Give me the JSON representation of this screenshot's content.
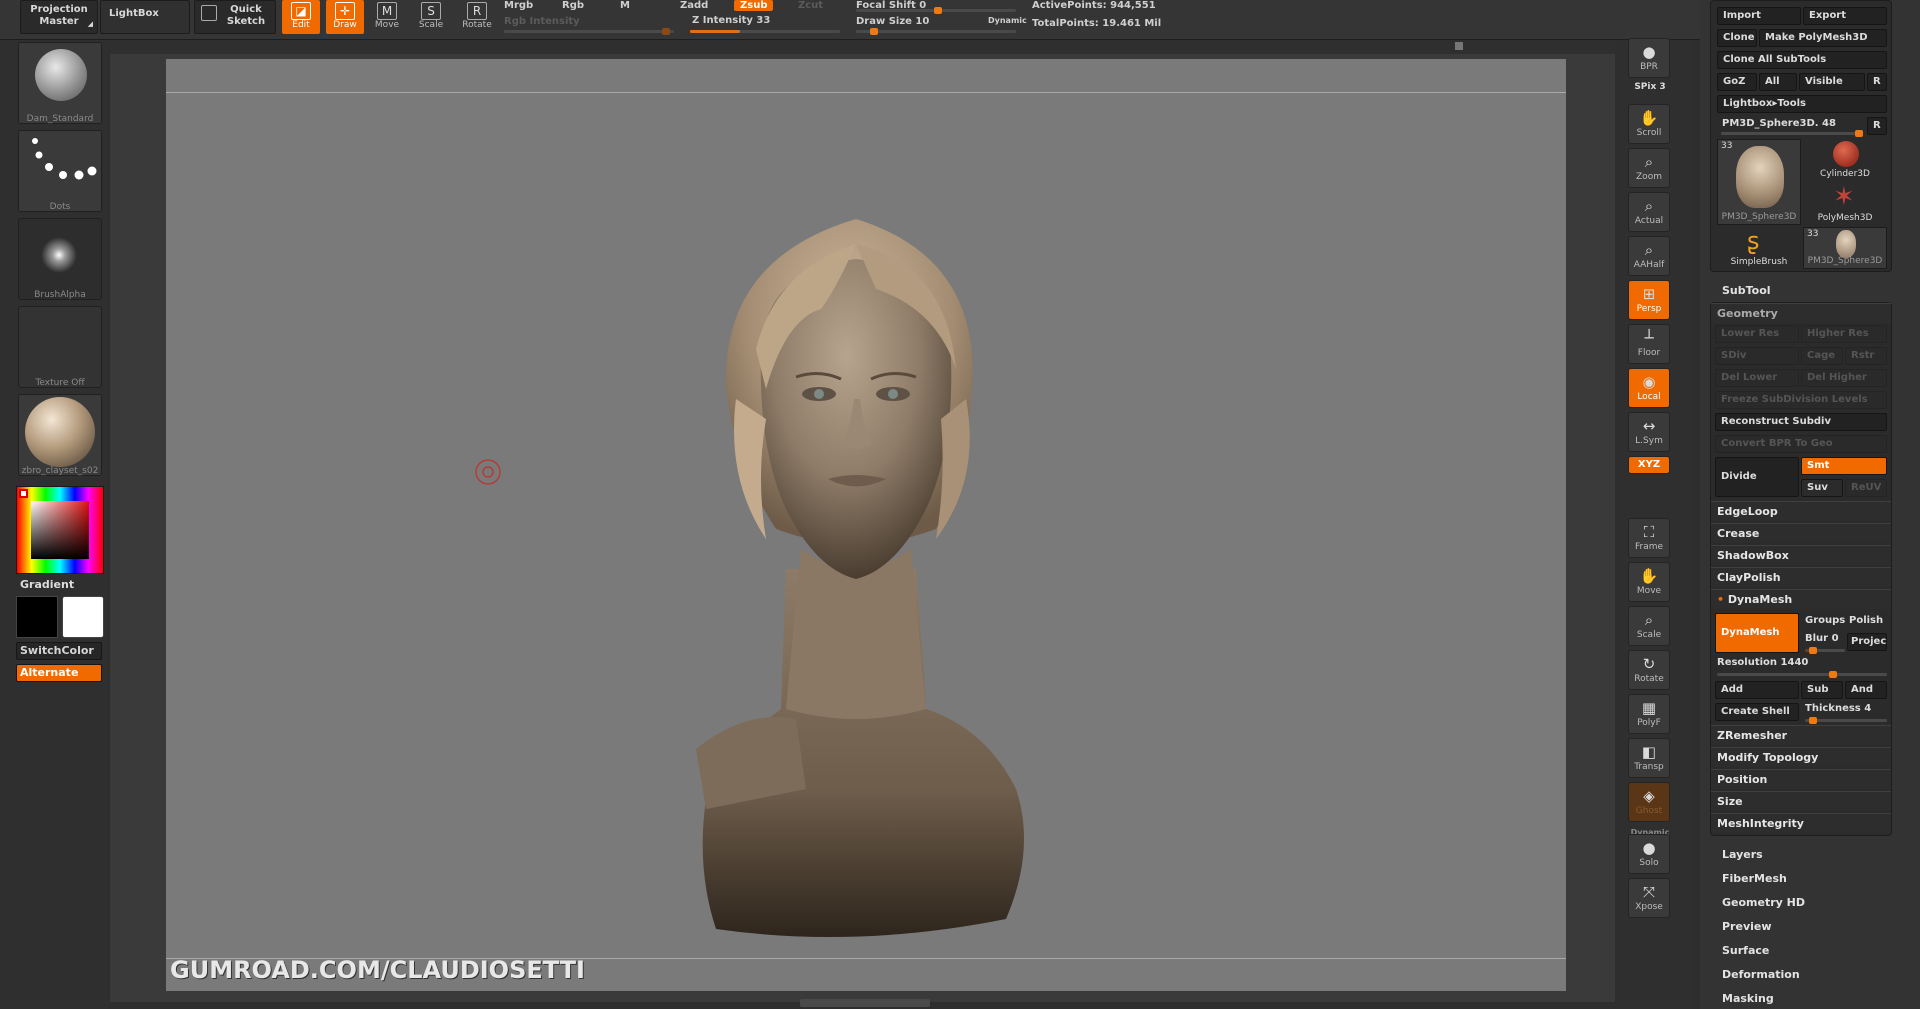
{
  "topbar": {
    "projection_master": "Projection Master",
    "lightbox": "LightBox",
    "quick_sketch": "Quick Sketch",
    "modes": [
      {
        "label": "Edit",
        "icon": "edit-icon",
        "active": true
      },
      {
        "label": "Draw",
        "icon": "draw-icon",
        "active": true
      },
      {
        "label": "Move",
        "icon": "move-icon",
        "active": false
      },
      {
        "label": "Scale",
        "icon": "scale-icon",
        "active": false
      },
      {
        "label": "Rotate",
        "icon": "rotate-icon",
        "active": false
      }
    ],
    "mrgb": "Mrgb",
    "rgb": "Rgb",
    "m": "M",
    "rgb_intensity": "Rgb Intensity",
    "zadd": "Zadd",
    "zsub": "Zsub",
    "zcut": "Zcut",
    "z_intensity": "Z Intensity 33",
    "z_intensity_value": 33,
    "focal_shift": "Focal Shift 0",
    "draw_size": "Draw Size 10",
    "draw_size_value": 10,
    "dynamic": "Dynamic",
    "active_points": "ActivePoints: 944,551",
    "total_points": "TotalPoints: 19.461 Mil"
  },
  "left_shelf": {
    "brush": "Dam_Standard",
    "stroke": "Dots",
    "alpha": "BrushAlpha",
    "texture": "Texture Off",
    "material": "zbro_clayset_s02",
    "gradient": "Gradient",
    "switch_color": "SwitchColor",
    "alternate": "Alternate",
    "main_color": "#000000",
    "secondary_color": "#ffffff",
    "accent": "#f06a00"
  },
  "canvas": {
    "watermark": "GUMROAD.COM/CLAUDIOSETTI",
    "bg_color": "#7a7a7a",
    "model_color": "#9c8a78"
  },
  "right_shelf": [
    {
      "label": "BPR",
      "icon": "bpr-icon"
    },
    {
      "label": "SPix 3",
      "icon": "spix-slider"
    },
    {
      "label": "Scroll",
      "icon": "scroll-icon"
    },
    {
      "label": "Zoom",
      "icon": "zoom-icon"
    },
    {
      "label": "Actual",
      "icon": "actual-icon"
    },
    {
      "label": "AAHalf",
      "icon": "aahalf-icon"
    },
    {
      "label": "Persp",
      "icon": "persp-icon",
      "active": true
    },
    {
      "label": "Floor",
      "icon": "floor-icon"
    },
    {
      "label": "Local",
      "icon": "local-icon",
      "active": true
    },
    {
      "label": "L.Sym",
      "icon": "lsym-icon"
    },
    {
      "label": "XYZ",
      "icon": "xyz-icon",
      "active": true
    },
    {
      "label": "Frame",
      "icon": "frame-icon"
    },
    {
      "label": "Move",
      "icon": "move-icon"
    },
    {
      "label": "Scale",
      "icon": "scale-icon"
    },
    {
      "label": "Rotate",
      "icon": "rotate-icon"
    },
    {
      "label": "PolyF",
      "icon": "polyf-icon"
    },
    {
      "label": "Transp",
      "icon": "transp-icon"
    },
    {
      "label": "Ghost",
      "icon": "ghost-icon"
    },
    {
      "label": "Dynamic",
      "icon": "dynamic-icon"
    },
    {
      "label": "Solo",
      "icon": "solo-icon"
    },
    {
      "label": "Xpose",
      "icon": "xpose-icon"
    }
  ],
  "tool_panel": {
    "import": "Import",
    "export": "Export",
    "clone": "Clone",
    "make_polymesh": "Make PolyMesh3D",
    "clone_all": "Clone All SubTools",
    "goz": "GoZ",
    "all": "All",
    "visible": "Visible",
    "r": "R",
    "lightbox_tools": "Lightbox▸Tools",
    "current_tool": "PM3D_Sphere3D. 48",
    "tiles": [
      {
        "label": "PM3D_Sphere3D",
        "count": "33"
      },
      {
        "label": "Cylinder3D"
      },
      {
        "label": "PolyMesh3D"
      },
      {
        "label": "SimpleBrush"
      },
      {
        "label": "PM3D_Sphere3D",
        "count": "33"
      }
    ],
    "subtool": "SubTool"
  },
  "geometry": {
    "title": "Geometry",
    "lower_res": "Lower Res",
    "higher_res": "Higher Res",
    "sdiv": "SDiv",
    "cage": "Cage",
    "rstr": "Rstr",
    "del_lower": "Del Lower",
    "del_higher": "Del Higher",
    "freeze": "Freeze SubDivision Levels",
    "reconstruct": "Reconstruct Subdiv",
    "convert_bpr": "Convert BPR To Geo",
    "divide": "Divide",
    "smt": "Smt",
    "suv": "Suv",
    "reuv": "ReUV",
    "edgeloop": "EdgeLoop",
    "crease": "Crease",
    "shadowbox": "ShadowBox",
    "claypolish": "ClayPolish",
    "dynamesh_header": "DynaMesh",
    "dynamesh": "DynaMesh",
    "groups": "Groups",
    "polish": "Polish",
    "blur": "Blur 0",
    "project": "Projec",
    "resolution": "Resolution 1440",
    "resolution_value": 1440,
    "add": "Add",
    "sub": "Sub",
    "and": "And",
    "create_shell": "Create Shell",
    "thickness": "Thickness 4",
    "thickness_value": 4,
    "zremesher": "ZRemesher",
    "modify_topology": "Modify Topology",
    "position": "Position",
    "size": "Size",
    "mesh_integrity": "MeshIntegrity"
  },
  "sections": [
    "Layers",
    "FiberMesh",
    "Geometry HD",
    "Preview",
    "Surface",
    "Deformation",
    "Masking"
  ]
}
